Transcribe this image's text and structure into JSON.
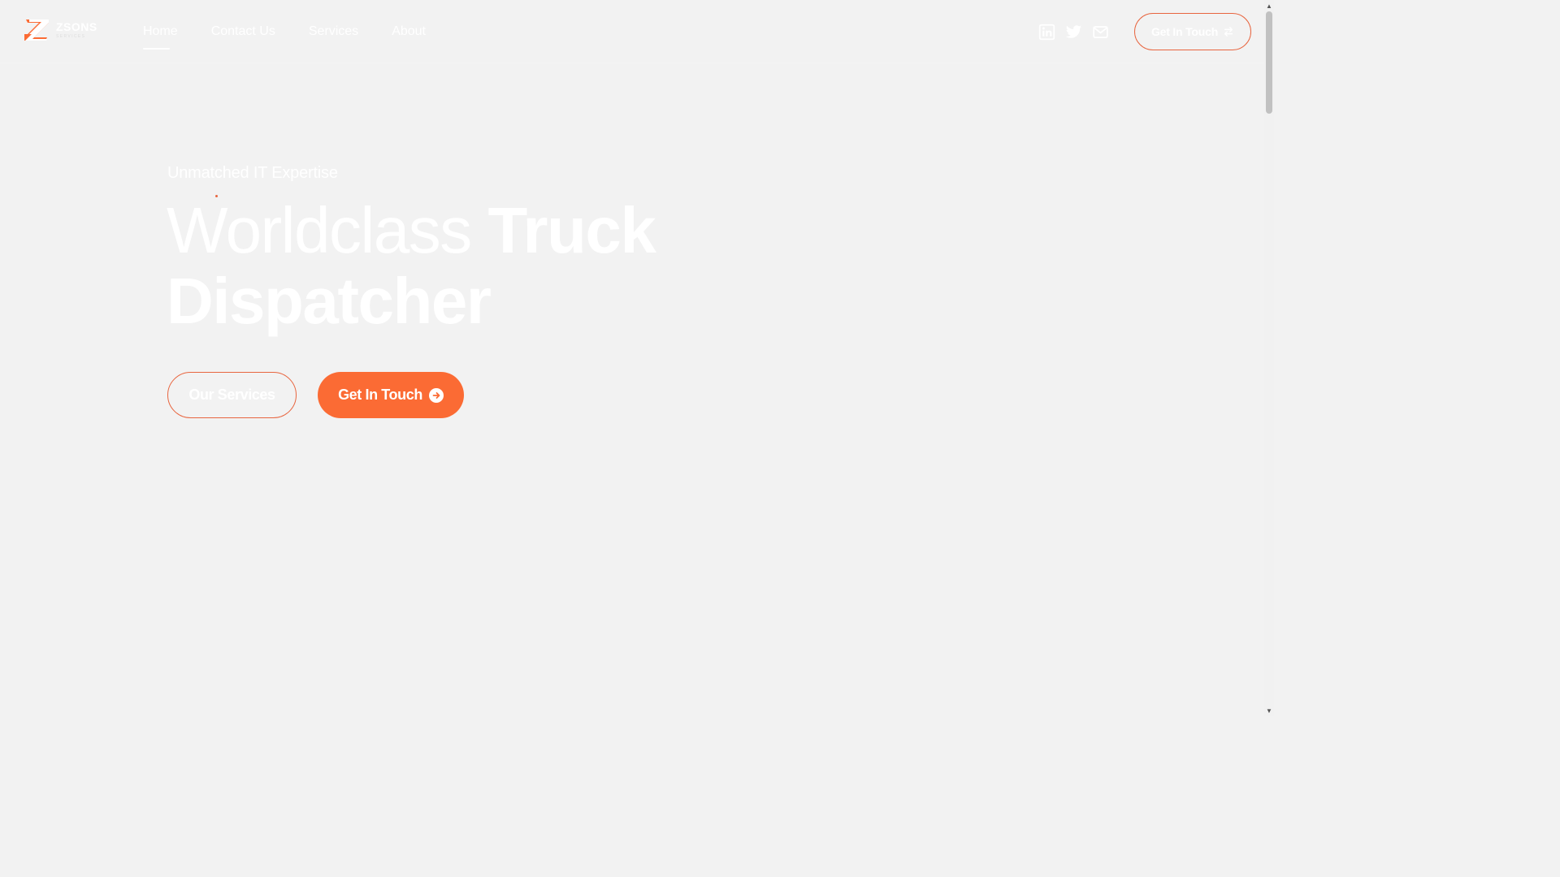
{
  "brand": {
    "name": "ZSONS",
    "subtitle": "SERVICES",
    "accent_color": "#fb6b34"
  },
  "nav": {
    "items": [
      {
        "label": "Home",
        "active": true
      },
      {
        "label": "Contact Us",
        "active": false
      },
      {
        "label": "Services",
        "active": false
      },
      {
        "label": "About",
        "active": false
      }
    ]
  },
  "socials": [
    "linkedin-icon",
    "twitter-icon",
    "mail-icon"
  ],
  "header_cta": {
    "label": "Get In Touch",
    "icon": "swap-arrows-icon"
  },
  "hero": {
    "eyebrow": "Unmatched IT Expertise",
    "headline_light": "Worldclass",
    "headline_bold_1": "Truck",
    "headline_bold_2": "Dispatcher",
    "primary_button": "Our Services",
    "secondary_button": "Get In Touch",
    "secondary_button_icon": "arrow-right-circle-icon"
  }
}
